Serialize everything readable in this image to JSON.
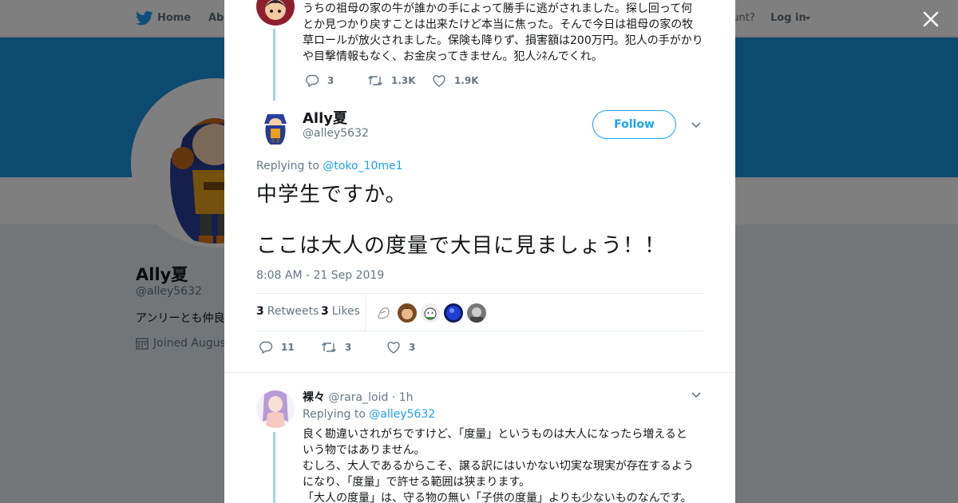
{
  "topbar": {
    "home_label": "Home",
    "about_label": "Abo",
    "account_text": "ccount?",
    "login_label": "Log in",
    "icons": [
      "twitter-bird-icon",
      "caret-down-icon"
    ]
  },
  "profile": {
    "name": "Ally夏",
    "handle": "@alley5632",
    "bio": "アンリーとも仲良",
    "joined": "Joined August"
  },
  "colors": {
    "accent": "#1da1f2",
    "banner": "#1b95e0",
    "thread_line": "#a0d2f3",
    "text_muted": "#657786"
  },
  "prev_tweet": {
    "text_lines": [
      "うちの祖母の家の牛が誰かの手によって勝手に逃がされました。探し回って何",
      "とか見つかり戻すことは出来たけど本当に焦った。そんで今日は祖母の家の牧",
      "草ロールが放火されました。保険も降りず、損害額は200万円。犯人の手がかり",
      "や目撃情報もなく、お金戻ってきません。犯人ｼﾈんでくれ。"
    ],
    "replies": "3",
    "retweets": "1.3K",
    "likes": "1.9K"
  },
  "main_tweet": {
    "name": "Ally夏",
    "handle": "@alley5632",
    "follow_label": "Follow",
    "replying_prefix": "Replying to",
    "replying_to": "@toko_10me1",
    "text_line1": "中学生ですか。",
    "text_line2": "ここは大人の度量で大目に見ましょう！！",
    "timestamp": "8:08 AM - 21 Sep 2019",
    "retweets_count": "3",
    "retweets_label": "Retweets",
    "likes_count": "3",
    "likes_label": "Likes",
    "replies": "11",
    "retweets": "3",
    "likes": "3"
  },
  "reply": {
    "name": "裸々",
    "handle": "@rara_loid",
    "time": "· 1h",
    "replying_prefix": "Replying to",
    "replying_to": "@alley5632",
    "text_lines": [
      "良く勘違いされがちですけど、「度量」というものは大人になったら増えると",
      "いう物ではありません。",
      "むしろ、大人であるからこそ、譲る訳にはいかない切実な現実が存在するよう",
      "になり、「度量」で許せる範囲は狭まります。",
      "「大人の度量」は、守る物の無い「子供の度量」よりも少ないものなんです。"
    ]
  }
}
